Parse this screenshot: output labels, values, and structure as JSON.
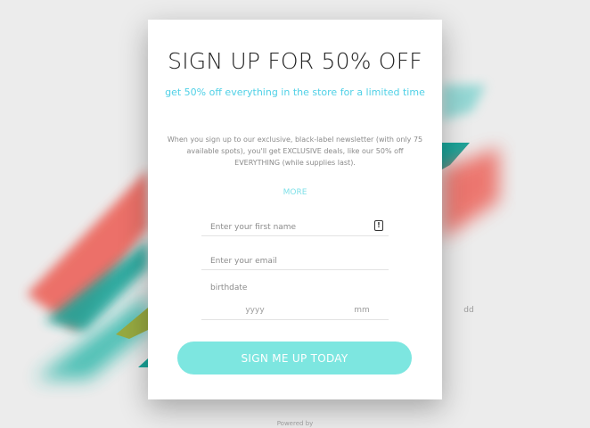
{
  "card": {
    "title": "SIGN UP FOR 50% OFF",
    "subtitle": "get 50% off everything in the store for a limited time",
    "description": "When you sign up to our exclusive, black-label newsletter (with only 75 available spots), you'll get EXCLUSIVE deals, like our 50% off EVERYTHING (while supplies last).",
    "more_label": "MORE"
  },
  "form": {
    "first_name_placeholder": "Enter your first name",
    "email_placeholder": "Enter your email",
    "birthdate_label": "birthdate",
    "year_placeholder": "yyyy",
    "month_placeholder": "mm",
    "day_placeholder": "dd",
    "submit_label": "SIGN ME UP TODAY"
  },
  "footer": {
    "powered_by": "Powered by"
  },
  "colors": {
    "accent": "#4fd0e6",
    "button": "#7de6e0",
    "coral": "#ec6a62",
    "teal": "#1aa59a",
    "olive": "#9aa93a"
  },
  "icons": {
    "field_alert": "alert-icon"
  }
}
